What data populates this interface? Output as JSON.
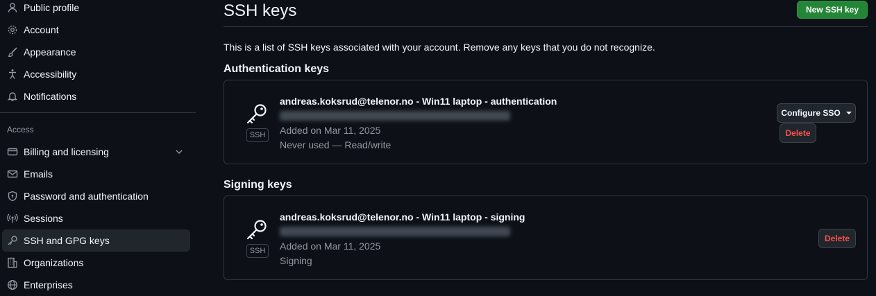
{
  "sidebar": {
    "items": [
      {
        "label": "Public profile",
        "icon": "person-icon"
      },
      {
        "label": "Account",
        "icon": "gear-icon"
      },
      {
        "label": "Appearance",
        "icon": "paintbrush-icon"
      },
      {
        "label": "Accessibility",
        "icon": "accessibility-icon"
      },
      {
        "label": "Notifications",
        "icon": "bell-icon"
      }
    ],
    "access_heading": "Access",
    "access_items": [
      {
        "label": "Billing and licensing",
        "icon": "credit-card-icon"
      },
      {
        "label": "Emails",
        "icon": "mail-icon"
      },
      {
        "label": "Password and authentication",
        "icon": "shield-lock-icon"
      },
      {
        "label": "Sessions",
        "icon": "broadcast-icon"
      },
      {
        "label": "SSH and GPG keys",
        "icon": "key-icon"
      },
      {
        "label": "Organizations",
        "icon": "organization-icon"
      },
      {
        "label": "Enterprises",
        "icon": "globe-icon"
      }
    ]
  },
  "main": {
    "title": "SSH keys",
    "new_button": "New SSH key",
    "intro": "This is a list of SSH keys associated with your account. Remove any keys that you do not recognize.",
    "auth_section": {
      "title": "Authentication keys",
      "key": {
        "name": "andreas.koksrud@telenor.no - Win11 laptop - authentication",
        "badge": "SSH",
        "added": "Added on Mar 11, 2025",
        "usage": "Never used — Read/write",
        "configure_label": "Configure SSO",
        "delete_label": "Delete"
      }
    },
    "signing_section": {
      "title": "Signing keys",
      "key": {
        "name": "andreas.koksrud@telenor.no - Win11 laptop - signing",
        "badge": "SSH",
        "added": "Added on Mar 11, 2025",
        "usage": "Signing",
        "delete_label": "Delete"
      }
    }
  },
  "colors": {
    "background": "#0d1117",
    "primary_button": "#238636",
    "danger_text": "#f85149",
    "border": "#30363d"
  }
}
